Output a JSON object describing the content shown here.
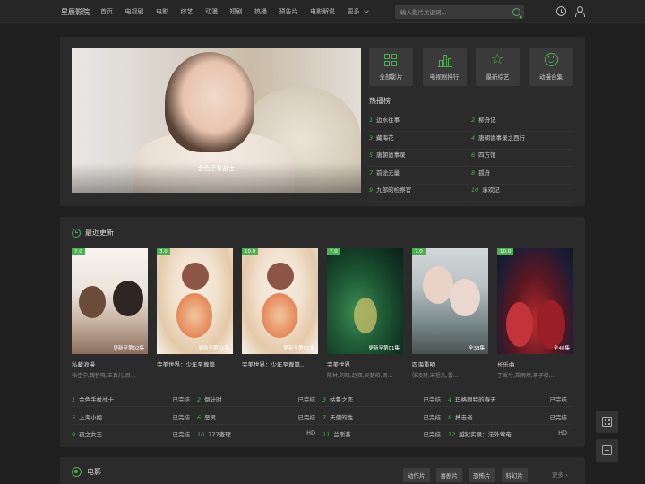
{
  "header": {
    "brand": "星辰影院",
    "nav": [
      "首页",
      "电视剧",
      "电影",
      "综艺",
      "动漫",
      "短剧",
      "热播",
      "预告片",
      "电影解说"
    ],
    "more_label": "更多",
    "search_placeholder": "输入影片关键词..."
  },
  "banner": {
    "caption": "金色手杖战士"
  },
  "quick_links": [
    {
      "label": "全部影片",
      "icon": "grid-icon"
    },
    {
      "label": "电视剧排行",
      "icon": "bar-chart-icon"
    },
    {
      "label": "最新综艺",
      "icon": "star-icon"
    },
    {
      "label": "动漫合集",
      "icon": "smile-icon"
    }
  ],
  "hot": {
    "title": "热播榜",
    "items": [
      {
        "num": "1",
        "title": "边水往事"
      },
      {
        "num": "2",
        "title": "柳舟记"
      },
      {
        "num": "3",
        "title": "藏海花"
      },
      {
        "num": "4",
        "title": "唐朝诡事录之西行"
      },
      {
        "num": "5",
        "title": "唐朝诡事录"
      },
      {
        "num": "6",
        "title": "四方馆"
      },
      {
        "num": "7",
        "title": "前途无量"
      },
      {
        "num": "8",
        "title": "孤舟"
      },
      {
        "num": "9",
        "title": "九部的检察官"
      },
      {
        "num": "10",
        "title": "承欢记"
      }
    ]
  },
  "recent": {
    "title": "最近更新",
    "posters": [
      {
        "score": "7.0",
        "title": "私藏浪漫",
        "actors": "张佳宁,魏哲鸣,王真儿,周…",
        "note": "更新至第02集"
      },
      {
        "score": "3.0",
        "title": "完美世界：少年至尊篇",
        "actors": "",
        "note": "更新至第01集"
      },
      {
        "score": "10.0",
        "title": "完美世界：少年至尊篇…",
        "actors": "",
        "note": "更新至第01集"
      },
      {
        "score": "7.0",
        "title": "完美世界",
        "actors": "陈林,刘晓,赵双,吴楚皎,周…",
        "note": "更新至第01集"
      },
      {
        "score": "7.0",
        "title": "四海重明",
        "actors": "张凌赫,宋祖儿,雷…",
        "note": "全38集"
      },
      {
        "score": "10.0",
        "title": "长乐曲",
        "actors": "丁禹兮,郑雨然,茅子俊,…",
        "note": "全40集"
      }
    ],
    "list": [
      [
        {
          "num": "1",
          "title": "金色手杖战士",
          "status": "已完结"
        },
        {
          "num": "2",
          "title": "倒计时",
          "status": "已完结"
        },
        {
          "num": "3",
          "title": "姑鲁之恋",
          "status": "已完结"
        },
        {
          "num": "4",
          "title": "玛格丽特的春天",
          "status": "已完结"
        }
      ],
      [
        {
          "num": "5",
          "title": "上海小姐",
          "status": "已完结"
        },
        {
          "num": "6",
          "title": "恶灵",
          "status": "已完结"
        },
        {
          "num": "7",
          "title": "天使的性",
          "status": "已完结"
        },
        {
          "num": "8",
          "title": "搏击者",
          "status": "已完结"
        }
      ],
      [
        {
          "num": "9",
          "title": "夜之女王",
          "status": "已完结"
        },
        {
          "num": "10",
          "title": "777查理",
          "status": "HD"
        },
        {
          "num": "11",
          "title": "兰斯基",
          "status": "已完结"
        },
        {
          "num": "12",
          "title": "越狱实录：法外莺奄",
          "status": "HD"
        }
      ]
    ]
  },
  "movies": {
    "title": "电影",
    "tags": [
      "动作片",
      "喜剧片",
      "恐怖片",
      "科幻片"
    ],
    "more": "更多"
  },
  "colors": {
    "accent": "#4caf50",
    "bg": "#202020",
    "panel": "#2b2b2b"
  }
}
